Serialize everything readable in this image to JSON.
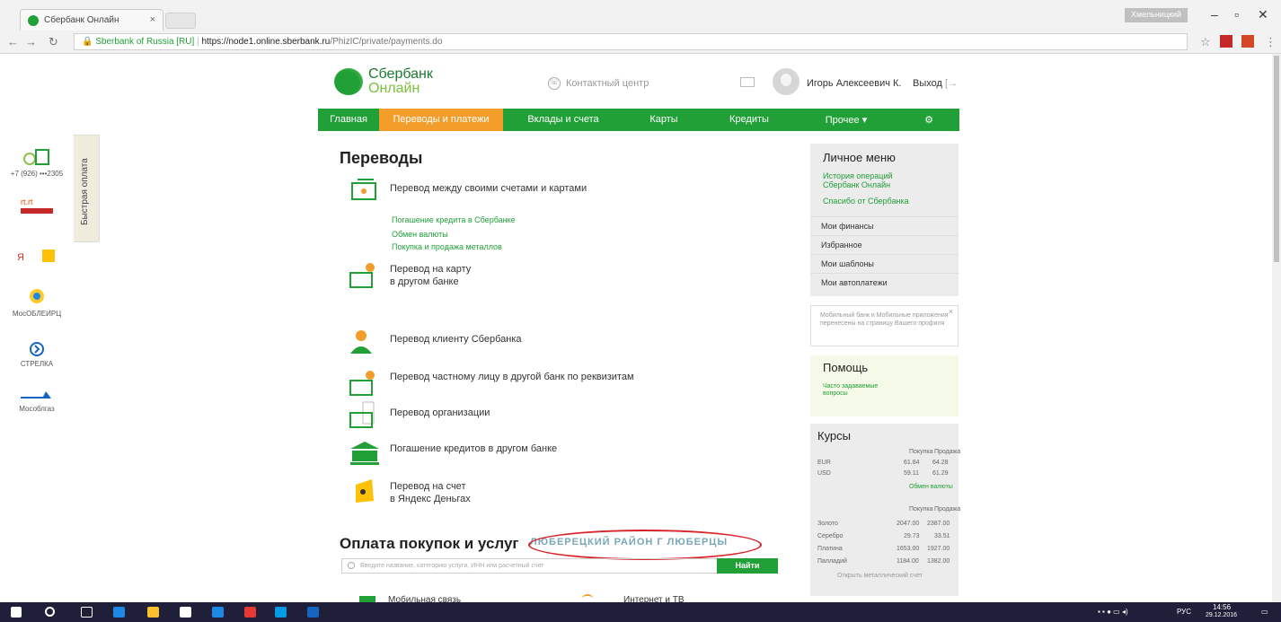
{
  "browser": {
    "tab_title": "Сбербанк Онлайн",
    "tab_close": "×",
    "profile": "Хмельницкий",
    "secure_label": "Sberbank of Russia [RU]",
    "url_host": "https://node1.online.sberbank.ru",
    "url_path": "/PhizIC/private/payments.do"
  },
  "header": {
    "logo_line1": "Сбербанк",
    "logo_line2": "Онлайн",
    "contact_center": "Контактный центр",
    "username": "Игорь Алексеевич К.",
    "logout": "Выход"
  },
  "nav": [
    {
      "label": "Главная",
      "active": false
    },
    {
      "label": "Переводы и платежи",
      "active": true
    },
    {
      "label": "Вклады и счета",
      "active": false
    },
    {
      "label": "Карты",
      "active": false
    },
    {
      "label": "Кредиты",
      "active": false
    },
    {
      "label": "Прочее ▾",
      "active": false
    },
    {
      "label": "⚙",
      "active": false
    }
  ],
  "quick_pay": {
    "tab_label": "Быстрая оплата",
    "items": [
      {
        "label": "+7 (926) •••2305",
        "icon": "phone-icon"
      },
      {
        "label": "",
        "icon": "rostelecom-icon"
      },
      {
        "label": "Яндекс",
        "icon": "yandex-icon"
      },
      {
        "label": "МосОБЛЕИРЦ",
        "icon": "mosoblerc-icon"
      },
      {
        "label": "СТРЕЛКА",
        "icon": "strelka-icon"
      },
      {
        "label": "Мособлгаз",
        "icon": "mosoblgaz-icon"
      }
    ]
  },
  "transfers": {
    "title": "Переводы",
    "own_accounts": "Перевод между своими счетами и картами",
    "sublinks": [
      "Погашение кредита в Сбербанке",
      "Обмен валюты",
      "Покупка и продажа металлов"
    ],
    "card_other_bank_1": "Перевод на карту",
    "card_other_bank_2": "в другом банке",
    "sber_client": "Перевод клиенту Сбербанка",
    "person_other_bank": "Перевод частному лицу в другой банк по реквизитам",
    "organization": "Перевод организации",
    "loan_other_bank": "Погашение кредитов в другом банке",
    "yandex_1": "Перевод на счет",
    "yandex_2": "в Яндекс Деньгах"
  },
  "payments": {
    "title": "Оплата покупок и услуг",
    "region": "ЛЮБЕРЕЦКИЙ РАЙОН Г ЛЮБЕРЦЫ",
    "search_placeholder": "Введите название, категорию услуги, ИНН или расчетный счет",
    "search_button": "Найти",
    "cat_mobile": "Мобильная связь",
    "cat_internet": "Интернет и ТВ"
  },
  "personal_menu": {
    "title": "Личное меню",
    "history_1": "История операций",
    "history_2": "Сбербанк Онлайн",
    "thanks": "Спасибо от Сбербанка",
    "items": [
      "Мои финансы",
      "Избранное",
      "Мои шаблоны",
      "Мои автоплатежи"
    ]
  },
  "notice": {
    "text": "Мобильный банк и Мобильные приложения перенесены на страницу Вашего профиля",
    "close": "×"
  },
  "help": {
    "title": "Помощь",
    "faq_1": "Часто задаваемые",
    "faq_2": "вопросы"
  },
  "rates": {
    "title": "Курсы",
    "col_buy": "Покупка",
    "col_sell": "Продажа",
    "currencies": [
      {
        "name": "EUR",
        "buy": "61.84",
        "sell": "64.28"
      },
      {
        "name": "USD",
        "buy": "59.11",
        "sell": "61.29"
      }
    ],
    "currency_link": "Обмен валюты",
    "metals": [
      {
        "name": "Золото",
        "buy": "2047.00",
        "sell": "2387.00"
      },
      {
        "name": "Серебро",
        "buy": "29.73",
        "sell": "33.51"
      },
      {
        "name": "Платина",
        "buy": "1653.00",
        "sell": "1927.00"
      },
      {
        "name": "Палладий",
        "buy": "1184.00",
        "sell": "1382.00"
      }
    ],
    "metal_link": "Открыть металлический счет"
  },
  "taskbar": {
    "lang": "РУС",
    "time": "14:56",
    "date": "29.12.2016"
  },
  "colors": {
    "brand": "#21a038",
    "active_tab": "#f39d2a",
    "annotation": "#d8232a"
  }
}
